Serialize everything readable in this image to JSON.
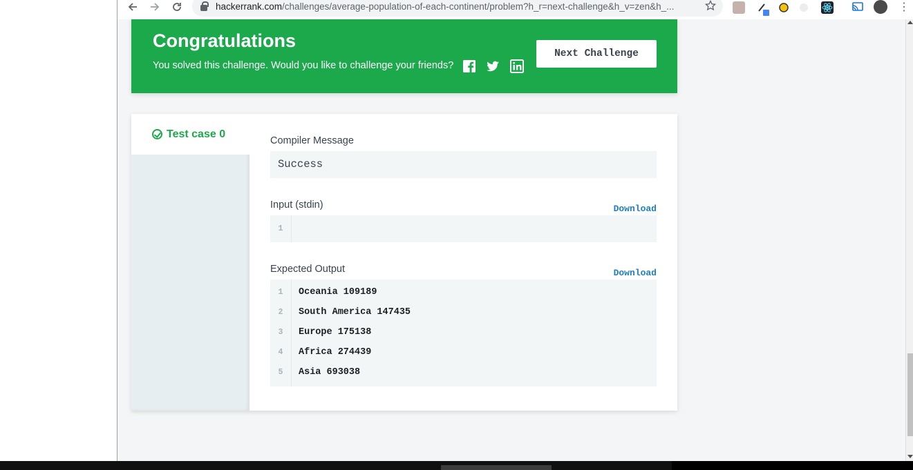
{
  "browser": {
    "url_host": "hackerrank.com",
    "url_path": "/challenges/average-population-of-each-continent/problem?h_r=next-challenge&h_v=zen&h_...",
    "back_icon": "arrow-left-icon",
    "forward_icon": "arrow-right-icon",
    "reload_icon": "reload-icon",
    "star_icon": "star-icon"
  },
  "congrats": {
    "title": "Congratulations",
    "message": "You solved this challenge. Would you like to challenge your friends?",
    "next_button": "Next Challenge",
    "accent": "#1ba94c"
  },
  "results": {
    "tab_label": "Test case 0",
    "compiler_label": "Compiler Message",
    "compiler_value": "Success",
    "input_label": "Input (stdin)",
    "input_download": "Download",
    "input_lines": [
      ""
    ],
    "output_label": "Expected Output",
    "output_download": "Download",
    "output_lines": [
      "Oceania 109189",
      "South America 147435",
      "Europe 175138",
      "Africa 274439",
      "Asia 693038"
    ],
    "line_numbers": [
      "1",
      "2",
      "3",
      "4",
      "5"
    ],
    "input_line_numbers": [
      "1"
    ]
  }
}
